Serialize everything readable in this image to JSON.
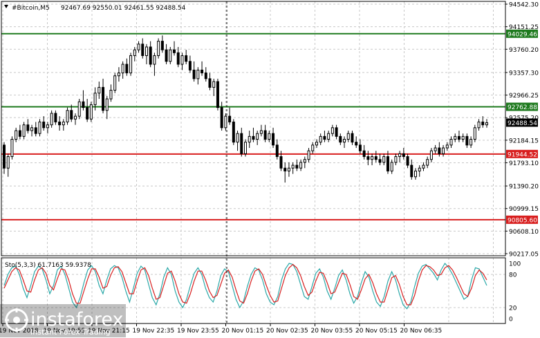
{
  "chart_data": [
    {
      "type": "candlestick",
      "symbol": "#Bitcoin,M5",
      "ohlc_header": "92467.69 92550.01 92461.55 92488.54",
      "last_price": 92488.54,
      "last_price_label": "92488.54",
      "y_ticks": [
        "94542.30",
        "94151.25",
        "93760.20",
        "93357.30",
        "92966.25",
        "92575.20",
        "92184.15",
        "91793.10",
        "91390.20",
        "90999.15",
        "90608.10",
        "90217.05"
      ],
      "ylim": [
        90217.05,
        94542.3
      ],
      "x_ticks": [
        "19 Nov 2018",
        "19 Nov 19:55",
        "19 Nov 21:15",
        "19 Nov 22:35",
        "19 Nov 23:55",
        "20 Nov 01:15",
        "20 Nov 02:35",
        "20 Nov 03:55",
        "20 Nov 05:15",
        "20 Nov 06:35"
      ],
      "grid": true,
      "levels": [
        {
          "value": 94029.46,
          "label": "94029.46",
          "color": "#1e7a1e"
        },
        {
          "value": 92762.88,
          "label": "92762.88",
          "color": "#1e7a1e"
        },
        {
          "value": 91944.52,
          "label": "91944.52",
          "color": "#d81e1e"
        },
        {
          "value": 90805.6,
          "label": "90805.60",
          "color": "#d81e1e"
        }
      ],
      "candles": [
        [
          92100,
          92150,
          91600,
          91700
        ],
        [
          91700,
          91950,
          91550,
          91900
        ],
        [
          91900,
          92250,
          91850,
          92200
        ],
        [
          92200,
          92400,
          92150,
          92350
        ],
        [
          92350,
          92450,
          92200,
          92250
        ],
        [
          92250,
          92500,
          92200,
          92450
        ],
        [
          92450,
          92550,
          92300,
          92350
        ],
        [
          92350,
          92450,
          92250,
          92400
        ],
        [
          92400,
          92500,
          92250,
          92300
        ],
        [
          92300,
          92550,
          92250,
          92500
        ],
        [
          92500,
          92600,
          92350,
          92400
        ],
        [
          92400,
          92500,
          92300,
          92450
        ],
        [
          92450,
          92700,
          92400,
          92650
        ],
        [
          92650,
          92700,
          92450,
          92500
        ],
        [
          92500,
          92600,
          92350,
          92450
        ],
        [
          92450,
          92550,
          92350,
          92500
        ],
        [
          92500,
          92750,
          92450,
          92700
        ],
        [
          92700,
          92800,
          92500,
          92550
        ],
        [
          92550,
          92650,
          92450,
          92600
        ],
        [
          92600,
          92900,
          92550,
          92850
        ],
        [
          92850,
          93050,
          92700,
          92750
        ],
        [
          92750,
          92900,
          92500,
          92550
        ],
        [
          92550,
          92850,
          92500,
          92800
        ],
        [
          92800,
          93100,
          92700,
          93000
        ],
        [
          93000,
          93200,
          92900,
          93100
        ],
        [
          93100,
          93250,
          92650,
          92700
        ],
        [
          92700,
          92950,
          92550,
          92900
        ],
        [
          92900,
          93150,
          92850,
          93050
        ],
        [
          93050,
          93350,
          93000,
          93300
        ],
        [
          93300,
          93450,
          93200,
          93350
        ],
        [
          93350,
          93550,
          93250,
          93500
        ],
        [
          93500,
          93600,
          93300,
          93350
        ],
        [
          93350,
          93700,
          93300,
          93650
        ],
        [
          93650,
          93800,
          93550,
          93750
        ],
        [
          93750,
          93900,
          93700,
          93850
        ],
        [
          93850,
          93950,
          93600,
          93650
        ],
        [
          93650,
          93850,
          93500,
          93800
        ],
        [
          93800,
          93900,
          93450,
          93500
        ],
        [
          93500,
          93700,
          93300,
          93650
        ],
        [
          93650,
          93950,
          93600,
          93900
        ],
        [
          93900,
          94000,
          93700,
          93750
        ],
        [
          93750,
          93850,
          93500,
          93550
        ],
        [
          93550,
          93800,
          93500,
          93750
        ],
        [
          93750,
          93900,
          93650,
          93700
        ],
        [
          93700,
          93800,
          93450,
          93500
        ],
        [
          93500,
          93700,
          93400,
          93650
        ],
        [
          93650,
          93750,
          93500,
          93550
        ],
        [
          93550,
          93650,
          93350,
          93400
        ],
        [
          93400,
          93550,
          93200,
          93250
        ],
        [
          93250,
          93450,
          93150,
          93400
        ],
        [
          93400,
          93550,
          93300,
          93350
        ],
        [
          93350,
          93450,
          93200,
          93250
        ],
        [
          93250,
          93350,
          93050,
          93100
        ],
        [
          93100,
          93250,
          92950,
          93200
        ],
        [
          93200,
          93250,
          92700,
          92750
        ],
        [
          92750,
          92850,
          92350,
          92400
        ],
        [
          92400,
          92650,
          92350,
          92600
        ],
        [
          92600,
          92750,
          92450,
          92500
        ],
        [
          92500,
          92550,
          92100,
          92150
        ],
        [
          92150,
          92350,
          92000,
          92300
        ],
        [
          92300,
          92400,
          91900,
          91950
        ],
        [
          91950,
          92200,
          91900,
          92150
        ],
        [
          92150,
          92350,
          92050,
          92250
        ],
        [
          92250,
          92400,
          92150,
          92200
        ],
        [
          92200,
          92350,
          92100,
          92300
        ],
        [
          92300,
          92450,
          92250,
          92350
        ],
        [
          92350,
          92450,
          92150,
          92200
        ],
        [
          92200,
          92350,
          92150,
          92300
        ],
        [
          92300,
          92400,
          92050,
          92100
        ],
        [
          92100,
          92200,
          91850,
          91900
        ],
        [
          91900,
          92000,
          91650,
          91700
        ],
        [
          91700,
          91800,
          91450,
          91650
        ],
        [
          91650,
          91800,
          91550,
          91700
        ],
        [
          91700,
          91800,
          91600,
          91750
        ],
        [
          91750,
          91850,
          91650,
          91700
        ],
        [
          91700,
          91850,
          91650,
          91800
        ],
        [
          91800,
          91900,
          91700,
          91850
        ],
        [
          91850,
          92050,
          91800,
          92000
        ],
        [
          92000,
          92150,
          91950,
          92100
        ],
        [
          92100,
          92200,
          92050,
          92150
        ],
        [
          92150,
          92300,
          92100,
          92250
        ],
        [
          92250,
          92350,
          92150,
          92200
        ],
        [
          92200,
          92350,
          92150,
          92300
        ],
        [
          92300,
          92450,
          92250,
          92400
        ],
        [
          92400,
          92450,
          92200,
          92250
        ],
        [
          92250,
          92300,
          92100,
          92150
        ],
        [
          92150,
          92250,
          92050,
          92200
        ],
        [
          92200,
          92350,
          92150,
          92300
        ],
        [
          92300,
          92350,
          92100,
          92150
        ],
        [
          92150,
          92250,
          92050,
          92100
        ],
        [
          92100,
          92200,
          91950,
          92000
        ],
        [
          92000,
          92100,
          91850,
          91900
        ],
        [
          91900,
          92000,
          91750,
          91850
        ],
        [
          91850,
          91950,
          91750,
          91900
        ],
        [
          91900,
          92000,
          91800,
          91850
        ],
        [
          91850,
          91950,
          91750,
          91800
        ],
        [
          91800,
          91950,
          91750,
          91900
        ],
        [
          91900,
          92000,
          91600,
          91650
        ],
        [
          91650,
          91850,
          91600,
          91800
        ],
        [
          91800,
          91950,
          91750,
          91900
        ],
        [
          91900,
          92000,
          91800,
          91950
        ],
        [
          91950,
          92050,
          91850,
          91900
        ],
        [
          91900,
          91950,
          91700,
          91750
        ],
        [
          91750,
          91850,
          91500,
          91550
        ],
        [
          91550,
          91700,
          91500,
          91650
        ],
        [
          91650,
          91750,
          91550,
          91700
        ],
        [
          91700,
          91800,
          91650,
          91750
        ],
        [
          91750,
          91900,
          91700,
          91850
        ],
        [
          91850,
          92050,
          91800,
          92000
        ],
        [
          92000,
          92100,
          91950,
          92050
        ],
        [
          92050,
          92150,
          91900,
          91950
        ],
        [
          91950,
          92100,
          91900,
          92050
        ],
        [
          92050,
          92150,
          92000,
          92100
        ],
        [
          92100,
          92250,
          92050,
          92200
        ],
        [
          92200,
          92300,
          92150,
          92250
        ],
        [
          92250,
          92350,
          92150,
          92200
        ],
        [
          92200,
          92300,
          92150,
          92250
        ],
        [
          92250,
          92300,
          92050,
          92100
        ],
        [
          92100,
          92250,
          92050,
          92200
        ],
        [
          92200,
          92450,
          92150,
          92400
        ],
        [
          92400,
          92550,
          92350,
          92500
        ],
        [
          92500,
          92600,
          92400,
          92450
        ],
        [
          92450,
          92550,
          92400,
          92488
        ]
      ]
    },
    {
      "type": "line",
      "label": "Sto(5,3,3) 61.7163 59.9378",
      "y_ticks": [
        "100",
        "80",
        "20",
        "0"
      ],
      "ylim": [
        0,
        100
      ],
      "series": [
        {
          "name": "main",
          "color": "#2aa8a8",
          "values": [
            60,
            80,
            92,
            95,
            80,
            55,
            38,
            60,
            85,
            95,
            90,
            70,
            45,
            60,
            88,
            95,
            80,
            55,
            30,
            20,
            38,
            65,
            88,
            96,
            85,
            60,
            45,
            70,
            90,
            96,
            92,
            75,
            50,
            30,
            55,
            82,
            95,
            88,
            62,
            38,
            25,
            45,
            75,
            92,
            80,
            50,
            30,
            20,
            35,
            60,
            82,
            92,
            80,
            55,
            38,
            30,
            50,
            78,
            90,
            85,
            60,
            35,
            20,
            32,
            58,
            80,
            92,
            88,
            70,
            45,
            30,
            25,
            40,
            70,
            90,
            100,
            98,
            85,
            62,
            40,
            35,
            58,
            82,
            90,
            75,
            50,
            35,
            55,
            78,
            88,
            70,
            45,
            28,
            40,
            65,
            85,
            75,
            50,
            30,
            22,
            40,
            68,
            85,
            70,
            45,
            25,
            18,
            30,
            58,
            82,
            95,
            98,
            90,
            82,
            70,
            88,
            100,
            92,
            80,
            65,
            50,
            35,
            40,
            70,
            92,
            90,
            75,
            60
          ]
        },
        {
          "name": "signal",
          "color": "#d81e1e",
          "values": [
            55,
            70,
            85,
            92,
            88,
            70,
            50,
            48,
            70,
            88,
            92,
            82,
            60,
            52,
            72,
            90,
            88,
            70,
            45,
            28,
            28,
            50,
            72,
            90,
            90,
            75,
            55,
            58,
            78,
            92,
            94,
            85,
            65,
            45,
            45,
            68,
            88,
            92,
            78,
            55,
            35,
            38,
            60,
            82,
            86,
            68,
            45,
            30,
            28,
            45,
            68,
            86,
            86,
            70,
            50,
            38,
            42,
            62,
            82,
            88,
            75,
            52,
            32,
            28,
            45,
            68,
            86,
            90,
            80,
            60,
            42,
            30,
            32,
            55,
            78,
            92,
            98,
            92,
            78,
            58,
            42,
            48,
            68,
            84,
            82,
            65,
            45,
            48,
            65,
            82,
            80,
            62,
            40,
            35,
            52,
            72,
            80,
            65,
            45,
            30,
            30,
            52,
            74,
            78,
            62,
            40,
            25,
            25,
            42,
            68,
            88,
            96,
            94,
            88,
            78,
            80,
            92,
            96,
            88,
            75,
            60,
            45,
            40,
            55,
            78,
            88,
            82,
            70
          ]
        }
      ]
    }
  ],
  "watermark": {
    "name": "instaforex",
    "tagline": "Instant Forex Trading"
  }
}
